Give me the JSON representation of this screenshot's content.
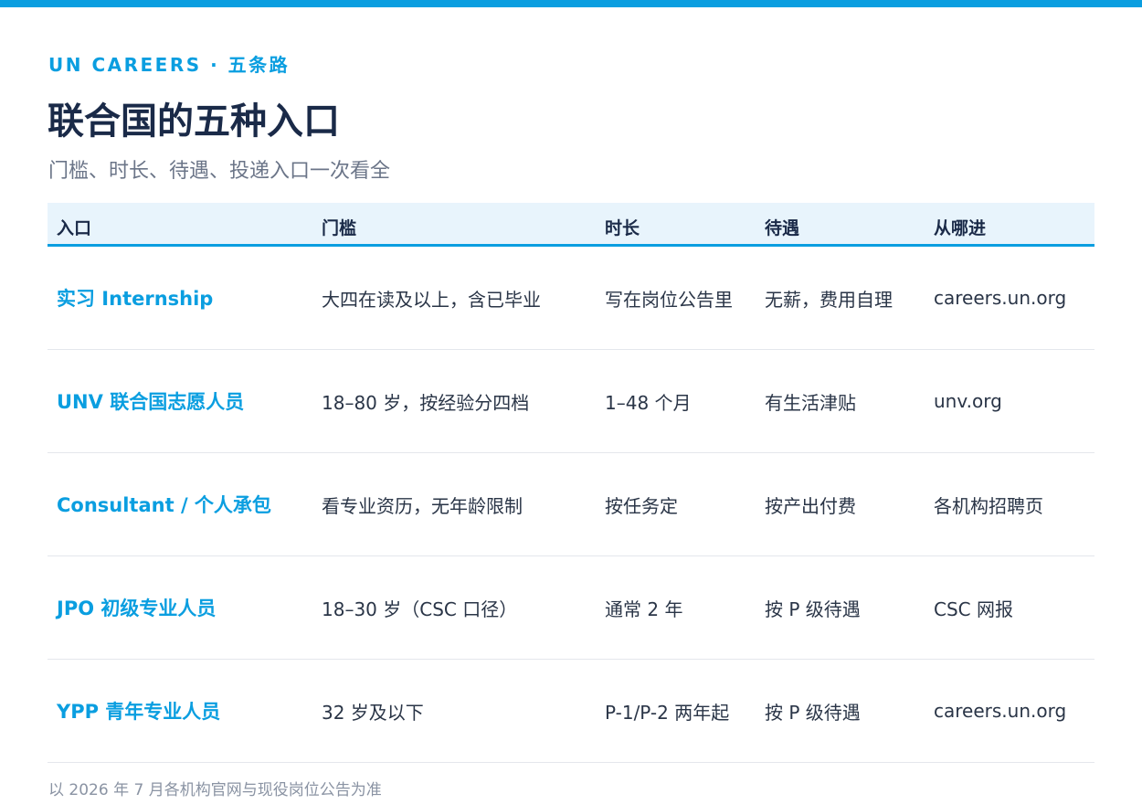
{
  "header": {
    "eyebrow": "UN CAREERS · 五条路",
    "title": "联合国的五种入口",
    "subtitle": "门槛、时长、待遇、投递入口一次看全"
  },
  "table": {
    "columns": [
      "入口",
      "门槛",
      "时长",
      "待遇",
      "从哪进"
    ],
    "rows": [
      [
        "实习 Internship",
        "大四在读及以上，含已毕业",
        "写在岗位公告里",
        "无薪，费用自理",
        "careers.un.org"
      ],
      [
        "UNV 联合国志愿人员",
        "18–80 岁，按经验分四档",
        "1–48 个月",
        "有生活津贴",
        "unv.org"
      ],
      [
        "Consultant / 个人承包",
        "看专业资历，无年龄限制",
        "按任务定",
        "按产出付费",
        "各机构招聘页"
      ],
      [
        "JPO 初级专业人员",
        "18–30 岁（CSC 口径）",
        "通常 2 年",
        "按 P 级待遇",
        "CSC 网报"
      ],
      [
        "YPP 青年专业人员",
        "32 岁及以下",
        "P-1/P-2 两年起",
        "按 P 级待遇",
        "careers.un.org"
      ]
    ]
  },
  "footnote": "以 2026 年 7 月各机构官网与现役岗位公告为准",
  "colors": {
    "accent": "#0a9ee0",
    "title": "#1a2a48",
    "header_bg": "#e8f4fc"
  }
}
